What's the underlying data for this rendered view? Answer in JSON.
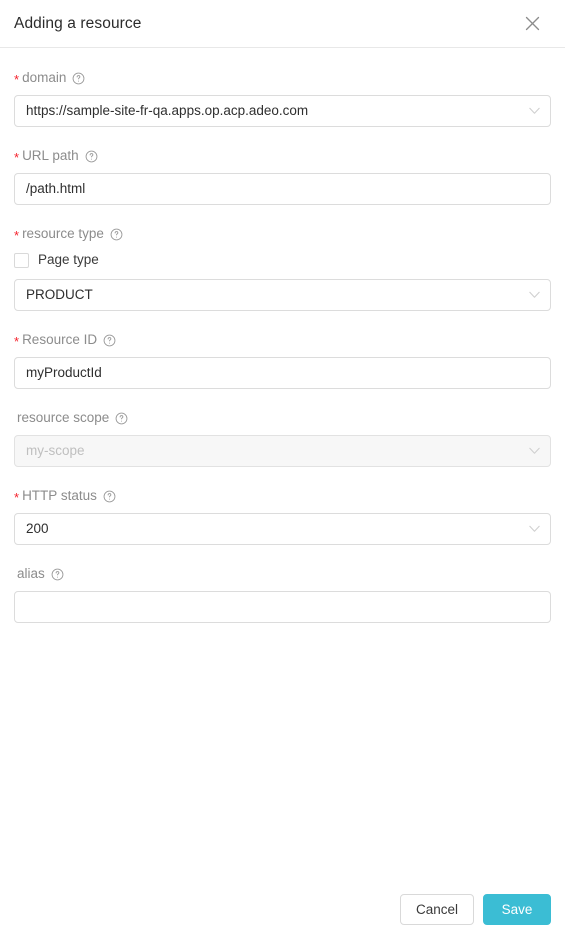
{
  "dialog": {
    "title": "Adding a resource",
    "close_icon": "close-icon"
  },
  "fields": {
    "domain": {
      "label": "domain",
      "required_marker": "*",
      "help_icon": "question-circle-icon",
      "value": "https://sample-site-fr-qa.apps.op.acp.adeo.com",
      "control": "select",
      "chevron_icon": "chevron-down-icon"
    },
    "url_path": {
      "label": "URL path",
      "required_marker": "*",
      "help_icon": "question-circle-icon",
      "value": "/path.html",
      "control": "input"
    },
    "resource_type": {
      "label": "resource type",
      "required_marker": "*",
      "help_icon": "question-circle-icon",
      "checkbox_label": "Page type",
      "checkbox_checked": false,
      "value": "PRODUCT",
      "control": "select",
      "chevron_icon": "chevron-down-icon"
    },
    "resource_id": {
      "label": "Resource ID",
      "required_marker": "*",
      "help_icon": "question-circle-icon",
      "value": "myProductId",
      "control": "input"
    },
    "resource_scope": {
      "label": "resource scope",
      "required_marker": "",
      "help_icon": "question-circle-icon",
      "placeholder": "my-scope",
      "value": "",
      "control": "select",
      "disabled": true,
      "chevron_icon": "chevron-down-icon"
    },
    "http_status": {
      "label": "HTTP status",
      "required_marker": "*",
      "help_icon": "question-circle-icon",
      "value": "200",
      "control": "select",
      "chevron_icon": "chevron-down-icon"
    },
    "alias": {
      "label": "alias",
      "required_marker": "",
      "help_icon": "question-circle-icon",
      "value": "",
      "placeholder": "",
      "control": "input"
    }
  },
  "footer": {
    "cancel_label": "Cancel",
    "save_label": "Save"
  },
  "colors": {
    "primary": "#3bbdd4",
    "required": "#f5222d",
    "label": "#8c8c8c",
    "border": "#dcdcdc",
    "disabled_bg": "#f7f7f7"
  }
}
